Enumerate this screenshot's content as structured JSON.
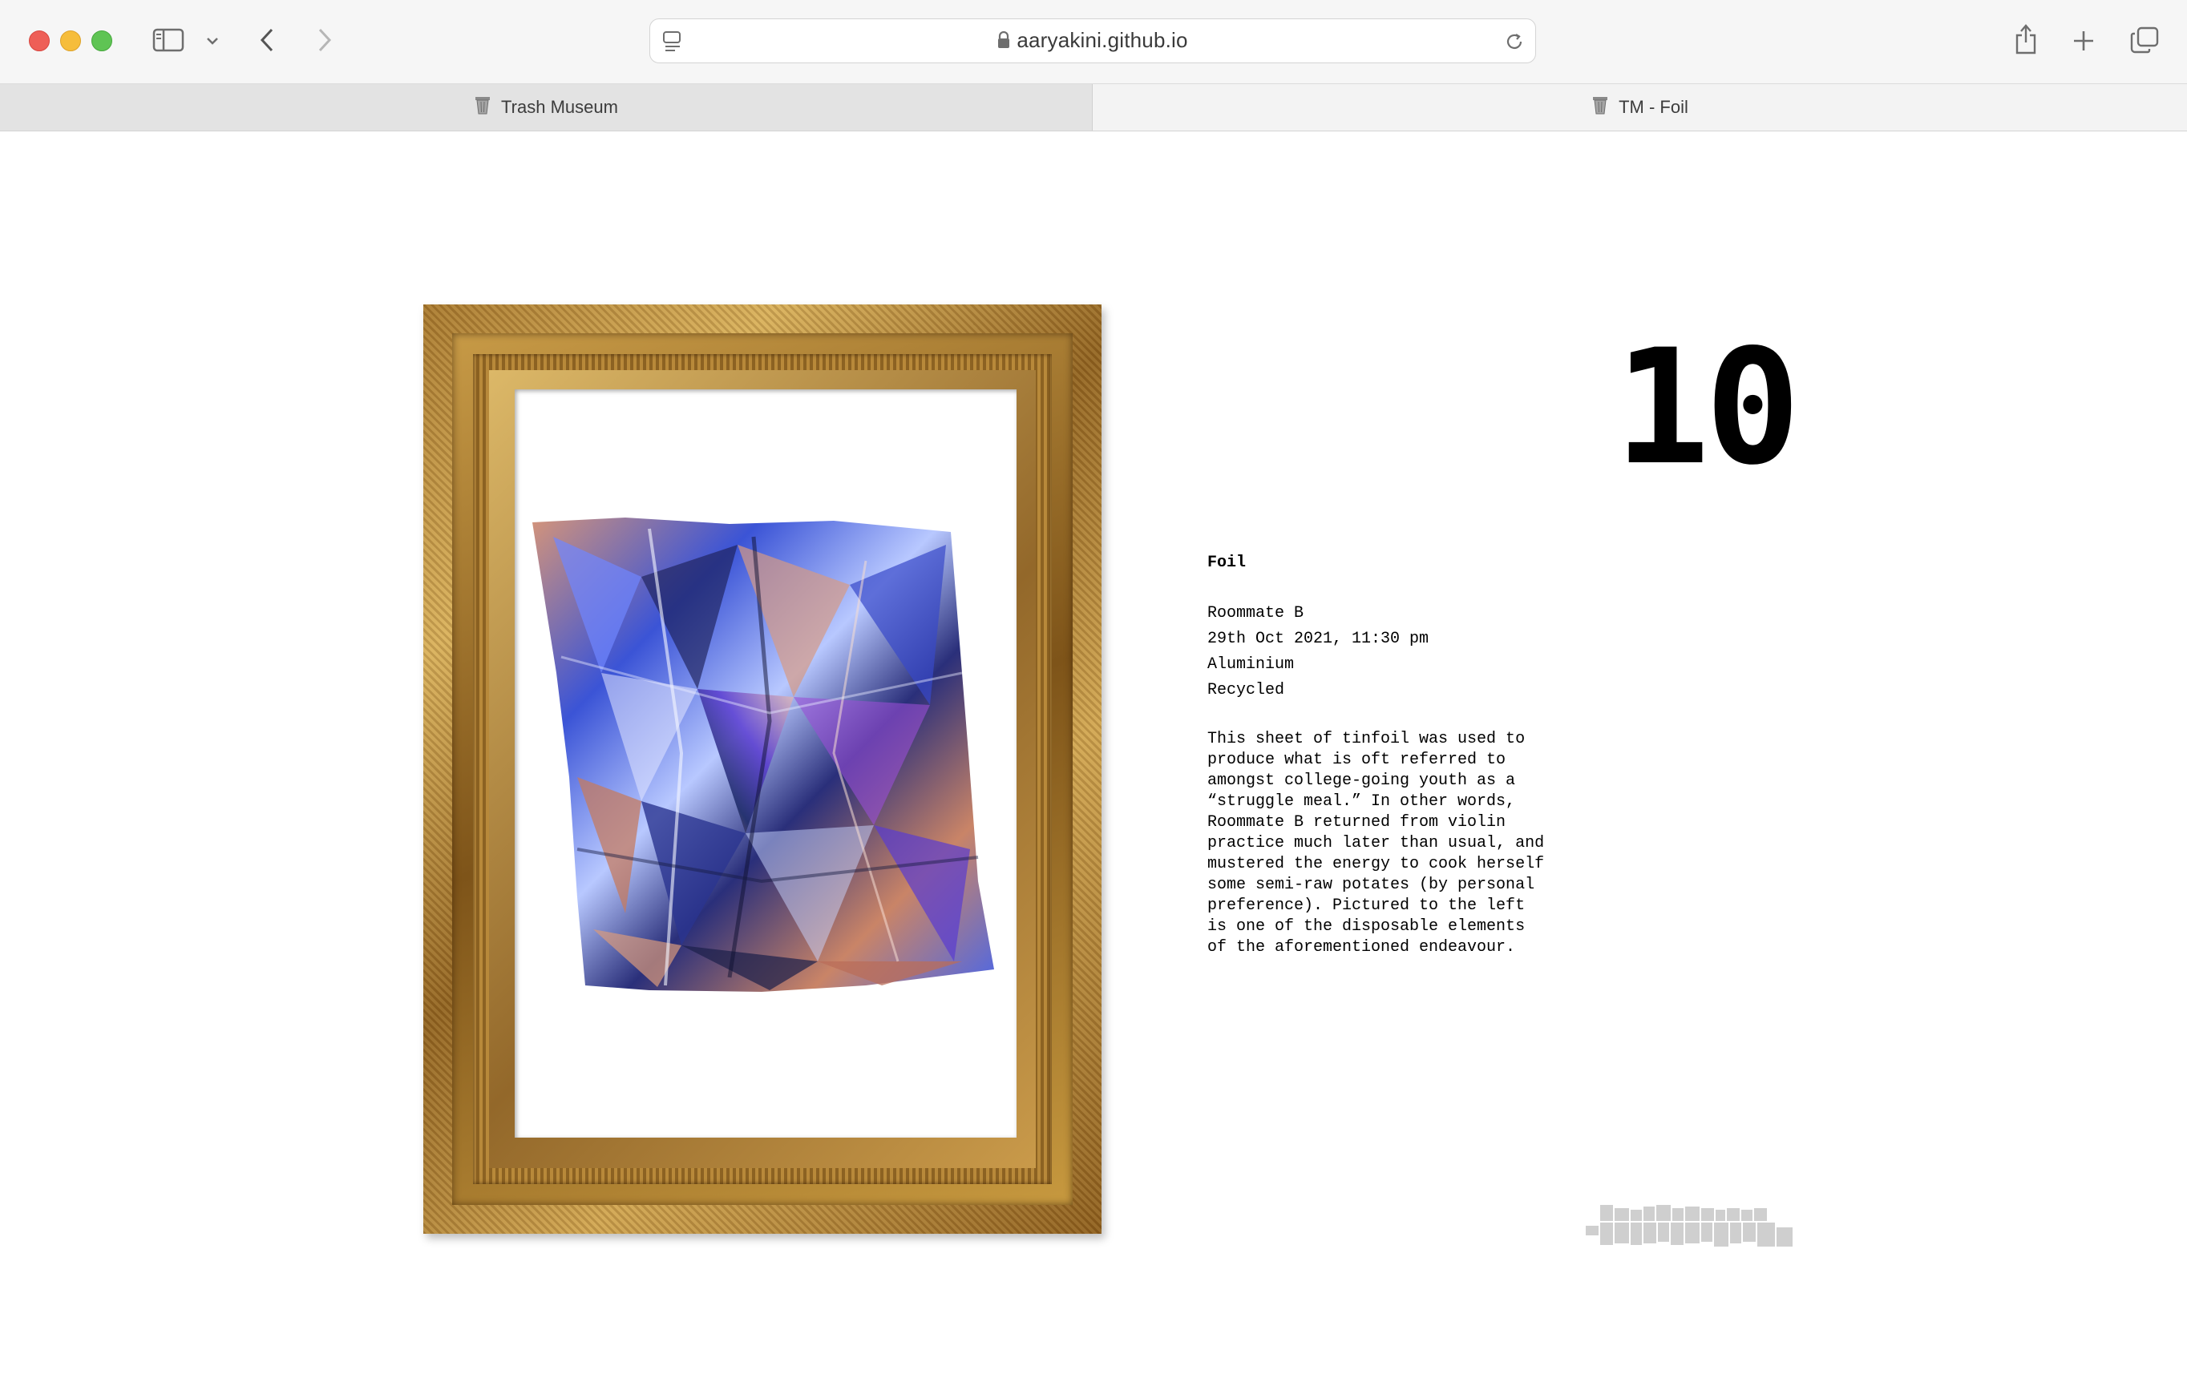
{
  "browser": {
    "url": "aaryakini.github.io",
    "tabs": [
      {
        "label": "Trash Museum",
        "active": false
      },
      {
        "label": "TM - Foil",
        "active": true
      }
    ]
  },
  "exhibit": {
    "number": "10",
    "title": "Foil",
    "meta": [
      "Roommate B",
      "29th Oct 2021, 11:30 pm",
      "Aluminium",
      "Recycled"
    ],
    "description": "This sheet of tinfoil was used to produce what is oft referred to amongst college-going youth as a “struggle meal.” In other words, Roommate B returned from violin practice much later than usual, and mustered the energy to cook herself some semi-raw potates (by personal preference). Pictured to the left is one of the disposable elements of the aforementioned endeavour."
  },
  "colors": {
    "frame_gold": "#b8893a",
    "foil_blue": "#3b54d6",
    "foil_copper": "#c98467",
    "logo_grey": "#cfcfcf"
  }
}
